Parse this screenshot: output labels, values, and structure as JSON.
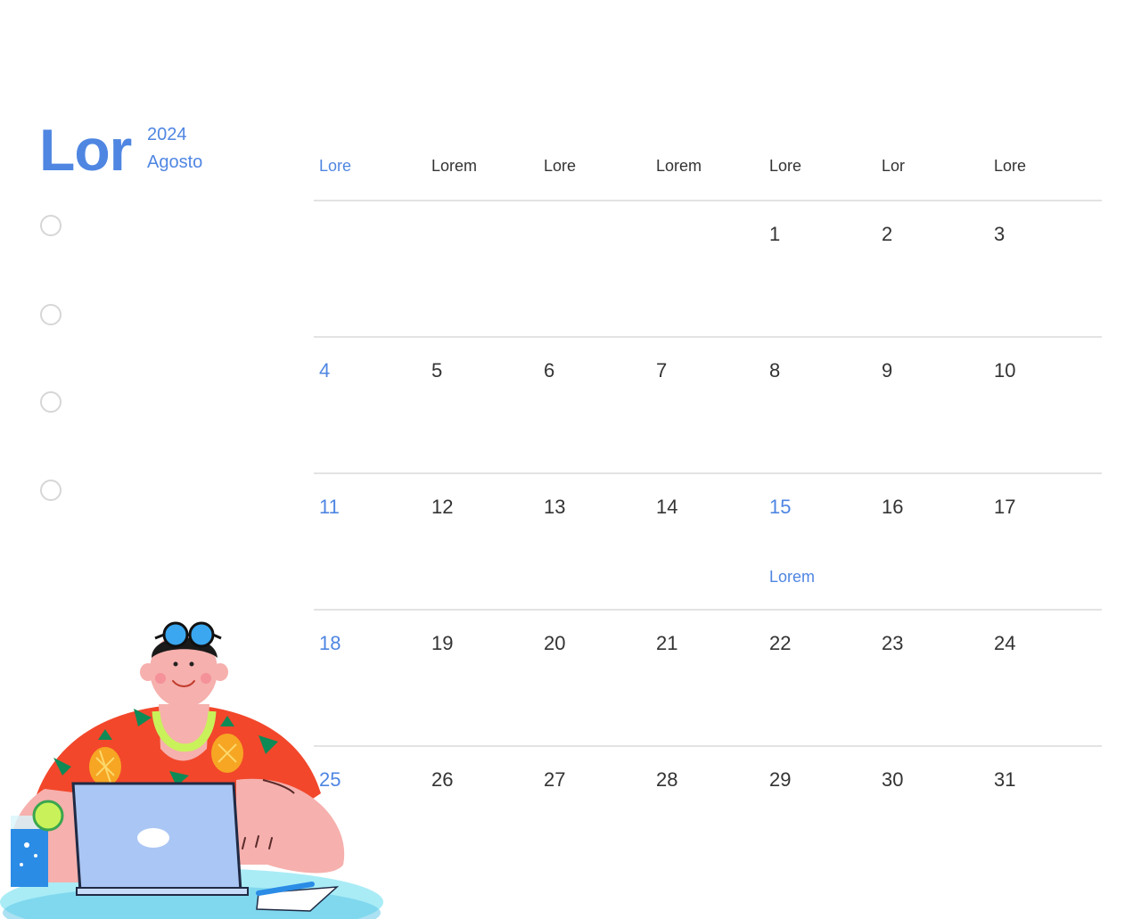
{
  "colors": {
    "accent": "#4f86e2",
    "text": "#333333",
    "divider": "#e3e3e3",
    "checkbox_border": "#d6d6d6"
  },
  "header": {
    "title": "Lor",
    "year": "2024",
    "month": "Agosto"
  },
  "checklist_count": 4,
  "calendar": {
    "weekdays": [
      "Lore",
      "Lorem",
      "Lore",
      "Lorem",
      "Lore",
      "Lor",
      "Lore"
    ],
    "weeks": [
      [
        "",
        "",
        "",
        "",
        "1",
        "2",
        "3"
      ],
      [
        "4",
        "5",
        "6",
        "7",
        "8",
        "9",
        "10"
      ],
      [
        "11",
        "12",
        "13",
        "14",
        "15",
        "16",
        "17"
      ],
      [
        "18",
        "19",
        "20",
        "21",
        "22",
        "23",
        "24"
      ],
      [
        "25",
        "26",
        "27",
        "28",
        "29",
        "30",
        "31"
      ]
    ],
    "highlighted_column": 0,
    "highlighted_days": [
      "15"
    ],
    "events": [
      {
        "day": "15",
        "text": "Lorem"
      }
    ]
  },
  "illustration": {
    "subject": "man-in-hawaiian-shirt-with-laptop",
    "icons": [
      "sunglasses-icon",
      "laptop-icon",
      "drink-glass-icon",
      "pen-icon"
    ]
  }
}
